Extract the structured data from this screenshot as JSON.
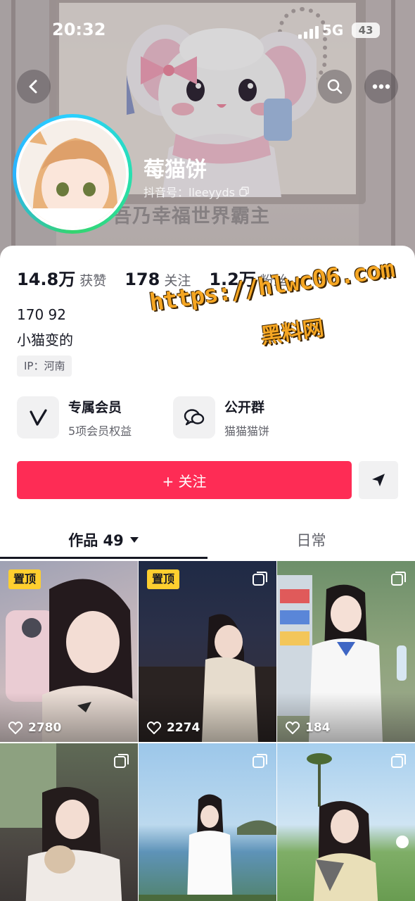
{
  "status_bar": {
    "time": "20:32",
    "network": "5G",
    "battery": "43"
  },
  "banner": {
    "caption": "吾乃幸福世界霸主"
  },
  "profile": {
    "nickname": "莓猫饼",
    "douyin_id": "抖音号：lleeyyds",
    "stats": [
      {
        "value": "14.8万",
        "label": "获赞"
      },
      {
        "value": "178",
        "label": "关注"
      },
      {
        "value": "1.2万",
        "label": "粉丝"
      }
    ],
    "bio_line1": "170 92",
    "bio_line2": "小猫变的",
    "ip": "IP：河南"
  },
  "watermark": {
    "url": "https://hlwc06.com",
    "brand": "黑料网"
  },
  "features": {
    "member": {
      "title": "专属会员",
      "subtitle": "5项会员权益"
    },
    "group": {
      "title": "公开群",
      "subtitle": "猫猫猫饼"
    }
  },
  "actions": {
    "follow_label": "+ 关注"
  },
  "tabs": {
    "works_label": "作品 49",
    "daily_label": "日常"
  },
  "grid": [
    {
      "pinned": "置顶",
      "likes": "2780",
      "multi": false
    },
    {
      "pinned": "置顶",
      "likes": "2274",
      "multi": true
    },
    {
      "pinned": "",
      "likes": "184",
      "multi": true
    },
    {
      "pinned": "",
      "likes": "",
      "multi": true
    },
    {
      "pinned": "",
      "likes": "",
      "multi": true
    },
    {
      "pinned": "",
      "likes": "",
      "multi": true
    }
  ],
  "colors": {
    "accent": "#fe2c55",
    "pin_badge": "#fecf2f",
    "text_primary": "#161823",
    "text_secondary": "#62636b"
  }
}
